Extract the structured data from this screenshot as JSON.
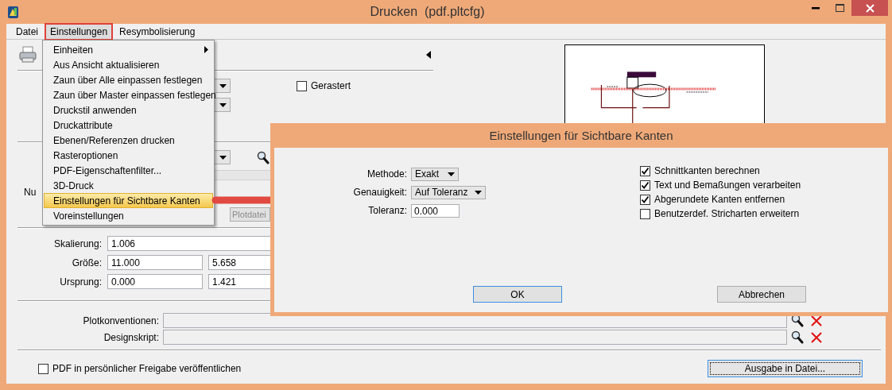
{
  "window": {
    "title": "Drucken  (pdf.pltcfg)"
  },
  "menu_bar": [
    {
      "label": "Datei",
      "selected": false
    },
    {
      "label": "Einstellungen",
      "selected": true
    },
    {
      "label": "Resymbolisierung",
      "selected": false
    }
  ],
  "settings_menu": {
    "items": [
      {
        "label": "Einheiten",
        "submenu": true,
        "selected": false
      },
      {
        "label": "Aus Ansicht aktualisieren",
        "submenu": false,
        "selected": false
      },
      {
        "label": "Zaun über Alle einpassen festlegen",
        "submenu": false,
        "selected": false
      },
      {
        "label": "Zaun über Master einpassen festlegen",
        "submenu": false,
        "selected": false
      },
      {
        "label": "Druckstil anwenden",
        "submenu": false,
        "selected": false
      },
      {
        "label": "Druckattribute",
        "submenu": false,
        "selected": false
      },
      {
        "label": "Ebenen/Referenzen drucken",
        "submenu": false,
        "selected": false
      },
      {
        "label": "Rasteroptionen",
        "submenu": false,
        "selected": false
      },
      {
        "label": "PDF-Eigenschaftenfilter...",
        "submenu": false,
        "selected": false
      },
      {
        "label": "3D-Druck",
        "submenu": false,
        "selected": false
      },
      {
        "label": "Einstellungen für Sichtbare Kanten",
        "submenu": false,
        "selected": true
      },
      {
        "label": "Voreinstellungen",
        "submenu": false,
        "selected": false
      }
    ]
  },
  "form": {
    "rasterized": {
      "label": "Gerastert",
      "checked": false
    },
    "partial_label": "Nu",
    "plot_file_button": "Plotdatei",
    "scaling": {
      "label": "Skalierung:",
      "value": "1.006"
    },
    "size": {
      "label": "Größe:",
      "values": [
        "11.000",
        "5.658"
      ]
    },
    "origin": {
      "label": "Ursprung:",
      "values": [
        "0.000",
        "1.421"
      ]
    },
    "plot_conventions": {
      "label": "Plotkonventionen:"
    },
    "design_script": {
      "label": "Designskript:"
    },
    "publish": {
      "label": "PDF in persönlicher Freigabe veröffentlichen",
      "checked": false
    },
    "output_button": "Ausgabe in Datei..."
  },
  "dialog": {
    "title": "Einstellungen für Sichtbare Kanten",
    "method": {
      "label": "Methode:",
      "value": "Exakt"
    },
    "accuracy": {
      "label": "Genauigkeit:",
      "value": "Auf Toleranz"
    },
    "tolerance": {
      "label": "Toleranz:",
      "value": "0.000"
    },
    "options": [
      {
        "label": "Schnittkanten berechnen",
        "checked": true
      },
      {
        "label": "Text und Bemaßungen verarbeiten",
        "checked": true
      },
      {
        "label": "Abgerundete Kanten entfernen",
        "checked": true
      },
      {
        "label": "Benutzerdef. Stricharten erweitern",
        "checked": false
      }
    ],
    "buttons": [
      "OK",
      "Abbrechen"
    ]
  }
}
